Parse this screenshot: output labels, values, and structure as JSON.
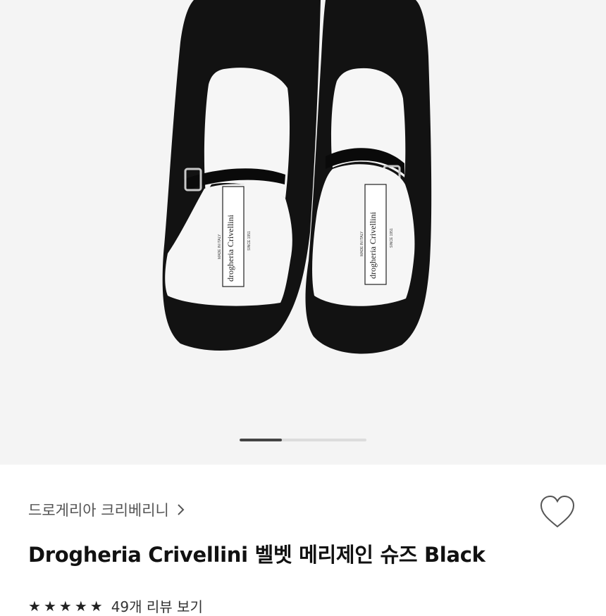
{
  "product_image": {
    "label_brand": "drogheria Crivellini",
    "label_made_in": "MADE IN ITALY",
    "label_since": "SINCE 1951",
    "colors": {
      "background": "#f4f4f4",
      "shoe": "#121212",
      "lining": "#f6f6f6"
    }
  },
  "carousel": {
    "total_slides": 3,
    "current_slide": 1
  },
  "product": {
    "brand": "드로게리아 크리베리니",
    "title": "Drogheria Crivellini 벨벳 메리제인 슈즈 Black",
    "rating_stars": 5,
    "review_link": "49개 리뷰 보기"
  },
  "icons": {
    "brand_chevron": "chevron-right-icon",
    "wishlist": "heart-outline-icon",
    "star": "star-icon"
  }
}
